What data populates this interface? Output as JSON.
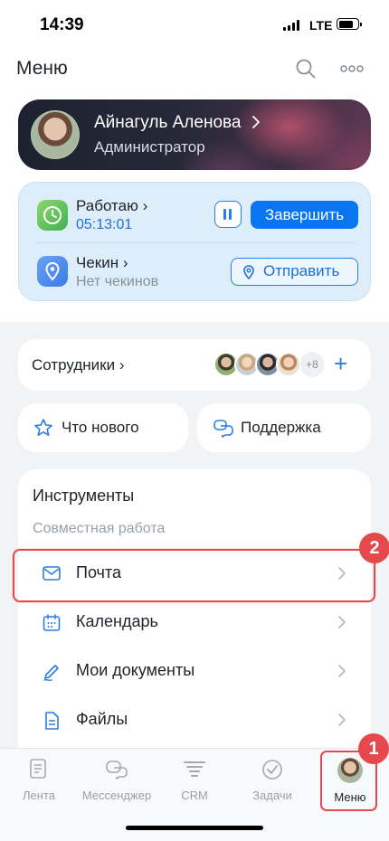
{
  "status_bar": {
    "time": "14:39",
    "network": "LTE"
  },
  "header": {
    "title": "Меню"
  },
  "profile": {
    "name": "Айнагуль Аленова",
    "role": "Администратор"
  },
  "work": {
    "status_label": "Работаю",
    "timer": "05:13:01",
    "finish_label": "Завершить",
    "checkin_label": "Чекин",
    "checkin_status": "Нет чекинов",
    "send_label": "Отправить"
  },
  "staff": {
    "label": "Сотрудники",
    "more_count": "+8"
  },
  "quick": {
    "news_label": "Что нового",
    "support_label": "Поддержка"
  },
  "tools": {
    "title": "Инструменты",
    "section": "Совместная работа",
    "items": [
      {
        "label": "Почта",
        "icon": "mail-icon"
      },
      {
        "label": "Календарь",
        "icon": "calendar-icon"
      },
      {
        "label": "Мои документы",
        "icon": "pen-icon"
      },
      {
        "label": "Файлы",
        "icon": "file-icon"
      }
    ]
  },
  "badges": {
    "first": "1",
    "second": "2"
  },
  "tabbar": {
    "tabs": [
      {
        "label": "Лента",
        "icon": "feed-icon"
      },
      {
        "label": "Мессенджер",
        "icon": "messenger-icon"
      },
      {
        "label": "CRM",
        "icon": "crm-icon"
      },
      {
        "label": "Задачи",
        "icon": "tasks-icon"
      },
      {
        "label": "Меню",
        "icon": "avatar"
      }
    ]
  },
  "colors": {
    "accent": "#0a75f0",
    "highlight": "#e5484d",
    "work_bg": "#ddeefa"
  }
}
